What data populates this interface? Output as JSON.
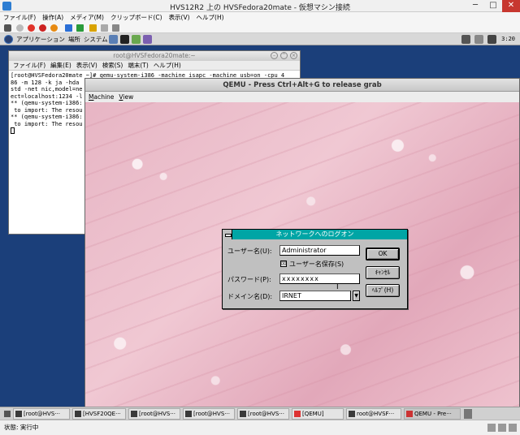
{
  "hyperv": {
    "title": "HVS12R2 上の HVSFedora20mate - 仮想マシン接続",
    "menu": [
      "ファイル(F)",
      "操作(A)",
      "メディア(M)",
      "クリップボード(C)",
      "表示(V)",
      "ヘルプ(H)"
    ],
    "status": "状態: 実行中"
  },
  "fedora": {
    "menu": [
      "アプリケーション",
      "場所",
      "システム"
    ],
    "clock": "3:20",
    "tasks": [
      "[root@HVS···",
      "[HVSF20QE···",
      "[root@HVS···",
      "[root@HVS···",
      "[root@HVS···",
      "[QEMU]",
      "root@HVSF···",
      "QEMU - Pre···"
    ]
  },
  "terminal": {
    "title": "root@HVSFedora20mate:~",
    "menu": [
      "ファイル(F)",
      "編集(E)",
      "表示(V)",
      "検索(S)",
      "端末(T)",
      "ヘルプ(H)"
    ],
    "lines": [
      "[root@HVSFedora20mate ~]# qemu-system-i386 -machine isapc -machine usb=on -cpu 4",
      "86 -m 128 -k ja -hda",
      "std -net nic,model=ne",
      "ect=localhost:1234 -l",
      "",
      "** (qemu-system-i386:",
      " to import: The resou",
      "",
      "** (qemu-system-i386:",
      " to import: The resou"
    ]
  },
  "qemu": {
    "title": "QEMU - Press Ctrl+Alt+G to release grab",
    "menu": [
      "Machine",
      "View"
    ]
  },
  "dialog": {
    "title": "ネットワークへのログオン",
    "username_label": "ユーザー名(U):",
    "username_value": "Administrator",
    "save_username_label": "ユーザー名保存(S)",
    "save_username_checked": "☒",
    "password_label": "パスワード(P):",
    "password_value": "xxxxxxxx",
    "domain_label": "ドメイン名(D):",
    "domain_value": "IRNET",
    "ok_label": "OK",
    "cancel_label": "ｷｬﾝｾﾙ",
    "help_label": "ﾍﾙﾌﾟ(H)"
  }
}
